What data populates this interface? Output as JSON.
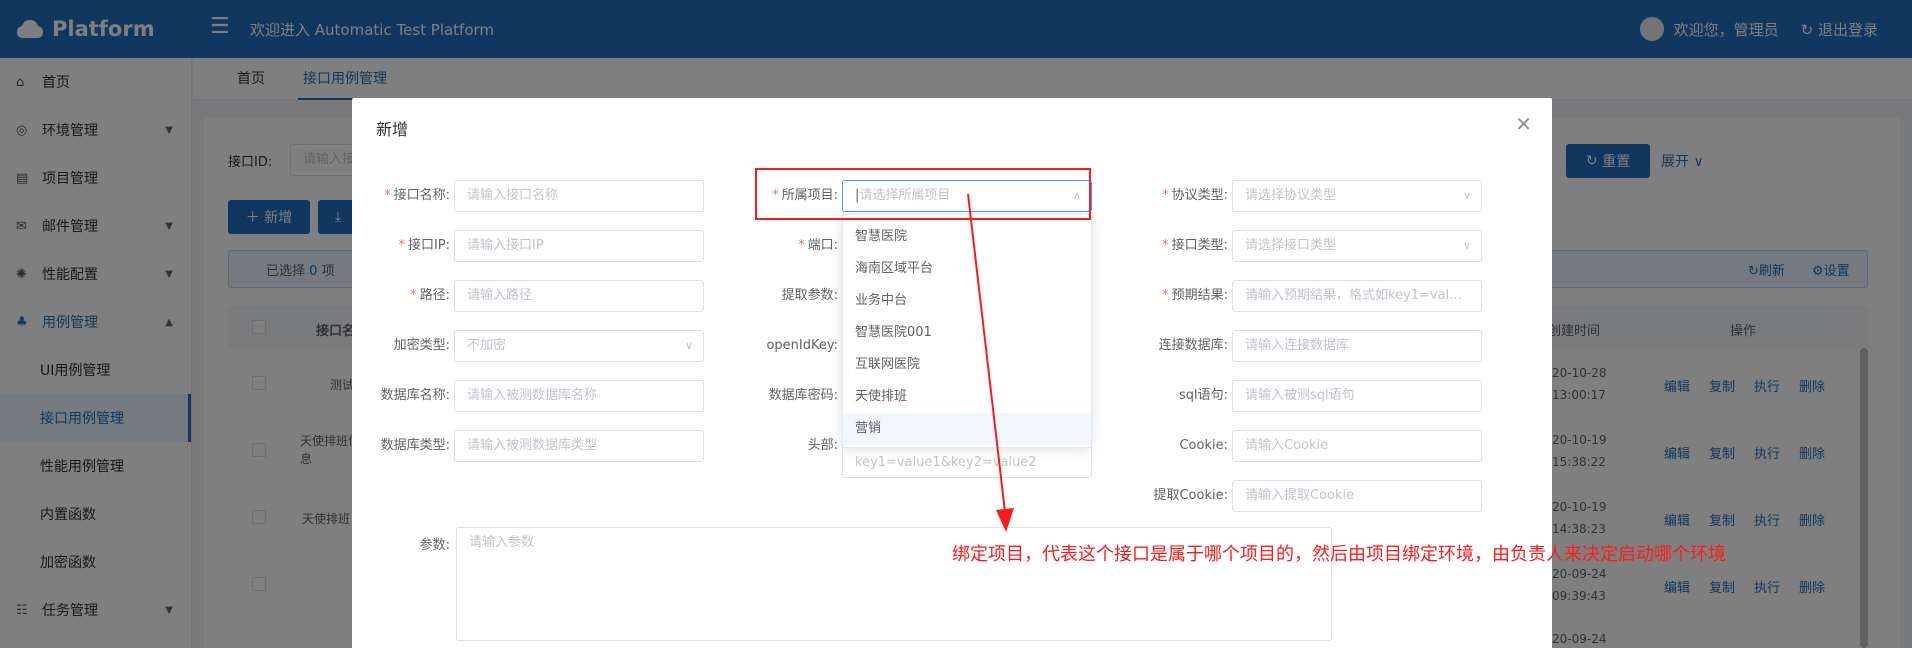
{
  "app": {
    "name": "Platform",
    "welcome": "欢迎进入 Automatic Test Platform",
    "user_greeting": "欢迎您，管理员",
    "logout": "退出登录"
  },
  "sidebar": {
    "items": [
      {
        "label": "首页",
        "icon": "home-icon"
      },
      {
        "label": "环境管理",
        "icon": "globe-icon"
      },
      {
        "label": "项目管理",
        "icon": "project-icon"
      },
      {
        "label": "邮件管理",
        "icon": "mail-icon"
      },
      {
        "label": "性能配置",
        "icon": "settings-icon"
      },
      {
        "label": "用例管理",
        "icon": "tree-icon"
      },
      {
        "label": "UI用例管理"
      },
      {
        "label": "接口用例管理"
      },
      {
        "label": "性能用例管理"
      },
      {
        "label": "内置函数"
      },
      {
        "label": "加密函数"
      },
      {
        "label": "任务管理",
        "icon": "list-icon"
      }
    ]
  },
  "tabs": [
    {
      "label": "首页"
    },
    {
      "label": "接口用例管理"
    }
  ],
  "background": {
    "filter_label": "接口ID:",
    "filter_placeholder": "请输入接",
    "reset": "重置",
    "expand": "展开",
    "add": "新增",
    "selected_prefix": "已选择",
    "selected_count": "0",
    "selected_suffix": "项",
    "refresh": "刷新",
    "settings": "设置",
    "columns": [
      "接口名",
      "创建时间",
      "操作"
    ],
    "rows": [
      {
        "name": "测试",
        "time_a": "20-10-28",
        "time_b": "13:00:17"
      },
      {
        "name": "天使排班信息",
        "time_a": "20-10-19",
        "time_b": "15:38:22"
      },
      {
        "name": "天使排班",
        "time_a": "20-10-19",
        "time_b": "14:38:23"
      },
      {
        "name": "",
        "time_a": "20-09-24",
        "time_b": "09:39:43"
      },
      {
        "name": "",
        "time_a": "20-09-24",
        "time_b": ""
      }
    ],
    "actions": [
      "编辑",
      "复制",
      "执行",
      "删除"
    ]
  },
  "dialog": {
    "title": "新增",
    "fields": [
      {
        "label": "接口名称:",
        "required": "*",
        "placeholder": "请输入接口名称"
      },
      {
        "label": "所属项目:",
        "required": "*",
        "placeholder": "请选择所属项目"
      },
      {
        "label": "协议类型:",
        "required": "*",
        "placeholder": "请选择协议类型"
      },
      {
        "label": "接口IP:",
        "required": "*",
        "placeholder": "请输入接口IP"
      },
      {
        "label": "端口:",
        "required": "*",
        "placeholder": ""
      },
      {
        "label": "接口类型:",
        "required": "*",
        "placeholder": "请选择接口类型"
      },
      {
        "label": "路径:",
        "required": "*",
        "placeholder": "请输入路径"
      },
      {
        "label": "提取参数:",
        "required": "",
        "placeholder": ""
      },
      {
        "label": "预期结果:",
        "required": "*",
        "placeholder": "请输入预期结果，格式如key1=val..."
      },
      {
        "label": "加密类型:",
        "required": "",
        "value": "不加密"
      },
      {
        "label": "openIdKey:",
        "required": "",
        "placeholder": ""
      },
      {
        "label": "连接数据库:",
        "required": "",
        "placeholder": "请输入连接数据库"
      },
      {
        "label": "数据库名称:",
        "required": "",
        "placeholder": "请输入被测数据库名称"
      },
      {
        "label": "数据库密码:",
        "required": "",
        "placeholder": ""
      },
      {
        "label": "sql语句:",
        "required": "",
        "placeholder": "请输入被测sql语句"
      },
      {
        "label": "数据库类型:",
        "required": "",
        "placeholder": "请输入被测数据库类型"
      },
      {
        "label": "头部:",
        "required": "",
        "placeholder": "key1=value1&key2=value2"
      },
      {
        "label": "Cookie:",
        "required": "",
        "placeholder": "请输入Cookie"
      },
      {
        "label": "提取Cookie:",
        "required": "",
        "placeholder": "请输入提取Cookie"
      },
      {
        "label": "参数:",
        "required": "",
        "placeholder": "请输入参数"
      }
    ],
    "project_options": [
      "智慧医院",
      "海南区域平台",
      "业务中台",
      "智慧医院001",
      "互联网医院",
      "天使排班",
      "营销"
    ]
  },
  "annotation": "绑定项目，代表这个接口是属于哪个项目的，然后由项目绑定环境，由负责人来决定启动哪个环境",
  "colors": {
    "primary": "#1e6fbf",
    "annotation": "#ff1a1a",
    "required": "#f56c6c"
  }
}
